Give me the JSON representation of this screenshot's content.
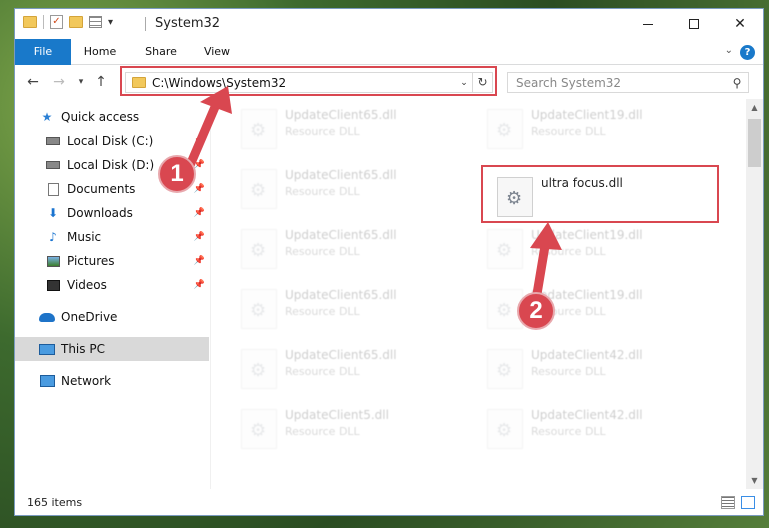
{
  "window": {
    "title": "System32"
  },
  "ribbon": {
    "tabs": [
      "File",
      "Home",
      "Share",
      "View"
    ]
  },
  "address": {
    "path": "C:\\Windows\\System32"
  },
  "search": {
    "placeholder": "Search System32"
  },
  "navpane": {
    "items": [
      {
        "label": "Quick access",
        "icon": "star-icon"
      },
      {
        "label": "Local Disk (C:)",
        "icon": "disk-icon"
      },
      {
        "label": "Local Disk (D:)",
        "icon": "disk-icon"
      },
      {
        "label": "Documents",
        "icon": "documents-icon"
      },
      {
        "label": "Downloads",
        "icon": "download-icon"
      },
      {
        "label": "Music",
        "icon": "music-icon"
      },
      {
        "label": "Pictures",
        "icon": "pictures-icon"
      },
      {
        "label": "Videos",
        "icon": "videos-icon"
      },
      {
        "label": "OneDrive",
        "icon": "cloud-icon"
      },
      {
        "label": "This PC",
        "icon": "pc-icon"
      },
      {
        "label": "Network",
        "icon": "network-icon"
      }
    ],
    "selected": "This PC"
  },
  "files": {
    "col1": [
      {
        "name": "UpdateClient65.dll",
        "type": "Resource DLL"
      },
      {
        "name": "UpdateClient65.dll",
        "type": "Resource DLL"
      },
      {
        "name": "UpdateClient65.dll",
        "type": "Resource DLL"
      },
      {
        "name": "UpdateClient65.dll",
        "type": "Resource DLL"
      },
      {
        "name": "UpdateClient65.dll",
        "type": "Resource DLL"
      },
      {
        "name": "UpdateClient5.dll",
        "type": "Resource DLL"
      }
    ],
    "col2": [
      {
        "name": "UpdateClient19.dll",
        "type": "Resource DLL"
      },
      {
        "name": "ultra focus.dll",
        "type": ""
      },
      {
        "name": "UpdateClient19.dll",
        "type": "Resource DLL"
      },
      {
        "name": "UpdateClient19.dll",
        "type": "Resource DLL"
      },
      {
        "name": "UpdateClient42.dll",
        "type": "Resource DLL"
      },
      {
        "name": "UpdateClient42.dll",
        "type": "Resource DLL"
      }
    ]
  },
  "status": {
    "item_count": "165 items"
  },
  "annotations": {
    "badge1": "1",
    "badge2": "2",
    "color": "#d94750"
  }
}
